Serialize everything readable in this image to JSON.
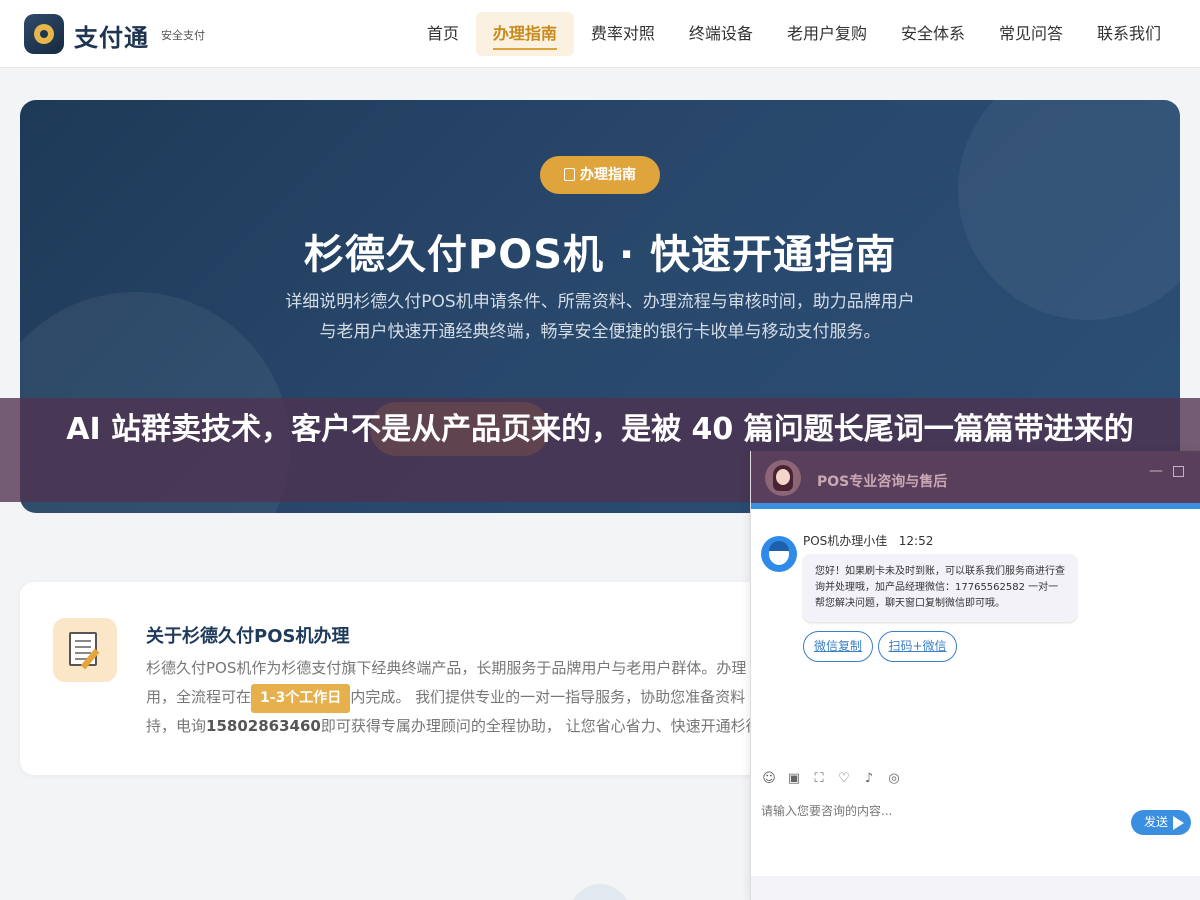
{
  "header": {
    "brand": "支付通",
    "brand_sub": "安全支付",
    "nav": [
      {
        "label": "首页",
        "active": false
      },
      {
        "label": "办理指南",
        "active": true
      },
      {
        "label": "费率对照",
        "active": false
      },
      {
        "label": "终端设备",
        "active": false
      },
      {
        "label": "老用户复购",
        "active": false
      },
      {
        "label": "安全体系",
        "active": false
      },
      {
        "label": "常见问答",
        "active": false
      },
      {
        "label": "联系我们",
        "active": false
      }
    ]
  },
  "hero": {
    "badge": "办理指南",
    "title": "杉德久付POS机 · 快速开通指南",
    "description": "详细说明杉德久付POS机申请条件、所需资料、办理流程与审核时间，助力品牌用户与老用户快速开通经典终端，畅享安全便捷的银行卡收单与移动支付服务。"
  },
  "banner": {
    "text": "AI 站群卖技术，客户不是从产品页来的，是被 40 篇问题长尾词一篇篇带进来的"
  },
  "about": {
    "title": "关于杉德久付POS机办理",
    "line1": "杉德久付POS机作为杉德支付旗下经典终端产品，长期服务于品牌用户与老用户群体。办理",
    "line2_a": "用，全流程可在",
    "line2_highlight": "1-3个工作日",
    "line2_b": "内完成。 我们提供专业的一对一指导服务，协助您准备资料",
    "line3_a": "持，电询",
    "line3_phone": "15802863460",
    "line3_b": "即可获得专属办理顾问的全程协助， 让您省心省力、快速开通杉德"
  },
  "chat": {
    "title": "POS专业咨询与售后",
    "agent_name": "POS机办理小佳",
    "time": "12:52",
    "message": "您好！如果刷卡未及时到账，可以联系我们服务商进行查询并处理哦，加产品经理微信：17765562582 一对一帮您解决问题，聊天窗口复制微信即可哦。",
    "quick_replies": [
      "微信复制",
      "扫码+微信"
    ],
    "input_placeholder": "请输入您要咨询的内容...",
    "send_label": "发送",
    "tools": [
      "emoji-icon",
      "image-icon",
      "screenshot-icon",
      "rating-icon",
      "voice-icon",
      "wechat-icon"
    ]
  }
}
